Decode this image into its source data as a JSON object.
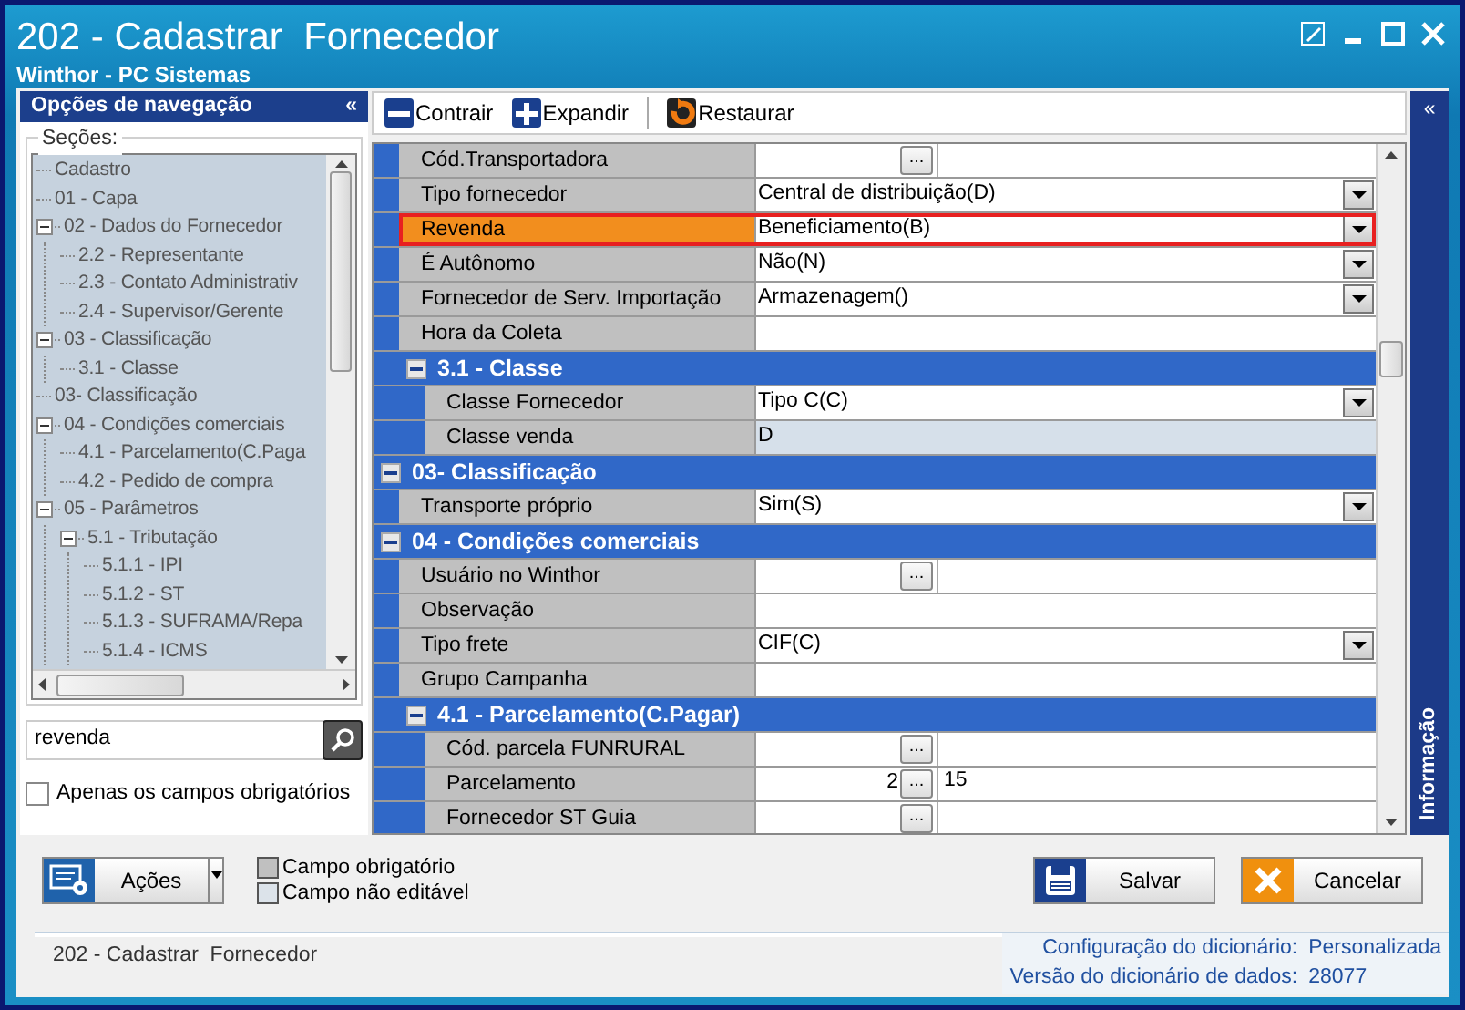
{
  "window": {
    "title": "202 - Cadastrar  Fornecedor",
    "subtitle": "Winthor - PC Sistemas"
  },
  "navigation": {
    "title": "Opções de navegação",
    "collapse": "«",
    "sections_label": "Seções:",
    "tree": [
      {
        "label": "Cadastro"
      },
      {
        "label": "01 - Capa"
      },
      {
        "label": "02 - Dados do Fornecedor",
        "expanded": true,
        "children": [
          {
            "label": "2.2 - Representante"
          },
          {
            "label": "2.3 - Contato Administrativ"
          },
          {
            "label": "2.4 - Supervisor/Gerente"
          }
        ]
      },
      {
        "label": "03 - Classificação",
        "expanded": true,
        "children": [
          {
            "label": "3.1 - Classe"
          }
        ]
      },
      {
        "label": "03- Classificação"
      },
      {
        "label": "04 - Condições comerciais",
        "expanded": true,
        "children": [
          {
            "label": "4.1 - Parcelamento(C.Paga"
          },
          {
            "label": "4.2 - Pedido de compra"
          }
        ]
      },
      {
        "label": "05 - Parâmetros",
        "expanded": true,
        "children": [
          {
            "label": "5.1 - Tributação",
            "expanded": true,
            "children": [
              {
                "label": "5.1.1 - IPI"
              },
              {
                "label": "5.1.2 - ST"
              },
              {
                "label": "5.1.3 - SUFRAMA/Repa"
              },
              {
                "label": "5.1.4 - ICMS"
              }
            ]
          }
        ]
      }
    ],
    "search": {
      "value": "revenda"
    },
    "required_only": {
      "label": "Apenas os campos obrigatórios",
      "checked": false
    }
  },
  "toolbar": [
    {
      "kind": "collapse",
      "label": "Contrair"
    },
    {
      "kind": "expand",
      "label": "Expandir"
    },
    {
      "kind": "restore",
      "label": "Restaurar"
    }
  ],
  "grid": [
    {
      "kind": "group",
      "children": [
        {
          "kind": "lookup",
          "label": "Cód.Transportadora",
          "button": "...",
          "selected": false
        },
        {
          "kind": "dropdown",
          "label": "Tipo fornecedor",
          "value": "Central de distribuição(D)",
          "selected": false
        },
        {
          "kind": "dropdown",
          "label": "Revenda",
          "value": "Beneficiamento(B)",
          "selected": true
        },
        {
          "kind": "dropdown",
          "label": "É Autônomo",
          "value": "Não(N)",
          "selected": false
        },
        {
          "kind": "dropdown",
          "label": "Fornecedor de Serv. Importação",
          "value": "Armazenagem()",
          "selected": false
        },
        {
          "kind": "text",
          "label": "Hora da Coleta",
          "selected": false
        },
        {
          "kind": "group",
          "title": "3.1 - Classe",
          "expanded": true,
          "children": [
            {
              "kind": "dropdown",
              "label": "Classe Fornecedor",
              "value": "Tipo C(C)",
              "selected": false
            },
            {
              "kind": "readonly",
              "label": "Classe venda",
              "value": "D",
              "selected": false
            }
          ]
        }
      ]
    },
    {
      "kind": "group",
      "title": "03- Classificação",
      "expanded": true,
      "children": [
        {
          "kind": "dropdown",
          "label": "Transporte próprio",
          "value": "Sim(S)",
          "selected": false
        }
      ]
    },
    {
      "kind": "group",
      "title": "04 - Condições comerciais",
      "expanded": true,
      "children": [
        {
          "kind": "lookup",
          "label": "Usuário no Winthor",
          "button": "...",
          "selected": false
        },
        {
          "kind": "text",
          "label": "Observação",
          "selected": false
        },
        {
          "kind": "dropdown",
          "label": "Tipo frete",
          "value": "CIF(C)",
          "selected": false
        },
        {
          "kind": "text",
          "label": "Grupo Campanha",
          "selected": false
        },
        {
          "kind": "group",
          "title": "4.1 - Parcelamento(C.Pagar)",
          "expanded": true,
          "children": [
            {
              "kind": "lookup",
              "label": "Cód. parcela FUNRURAL",
              "button": "...",
              "selected": false
            },
            {
              "kind": "lookup",
              "label": "Parcelamento",
              "code": "2",
              "button": "...",
              "description": "15",
              "selected": false
            },
            {
              "kind": "lookup",
              "label": "Fornecedor ST Guia",
              "button": "...",
              "selected": false
            }
          ]
        }
      ]
    }
  ],
  "info_panel": {
    "collapse": "«",
    "title": "Informação"
  },
  "actions_button": {
    "label": "Ações"
  },
  "legend": [
    {
      "label": "Campo obrigatório",
      "color": "#c0c0c0"
    },
    {
      "label": "Campo não editável",
      "color": "#dce3ea"
    }
  ],
  "buttons": [
    {
      "kind": "save",
      "label": "Salvar"
    },
    {
      "kind": "cancel",
      "label": "Cancelar"
    }
  ],
  "status_bar": {
    "text": "202 - Cadastrar  Fornecedor",
    "info": [
      {
        "label": "Configuração do dicionário:",
        "value": "Personalizada"
      },
      {
        "label": "Versão do dicionário de dados:",
        "value": "28077"
      }
    ]
  }
}
